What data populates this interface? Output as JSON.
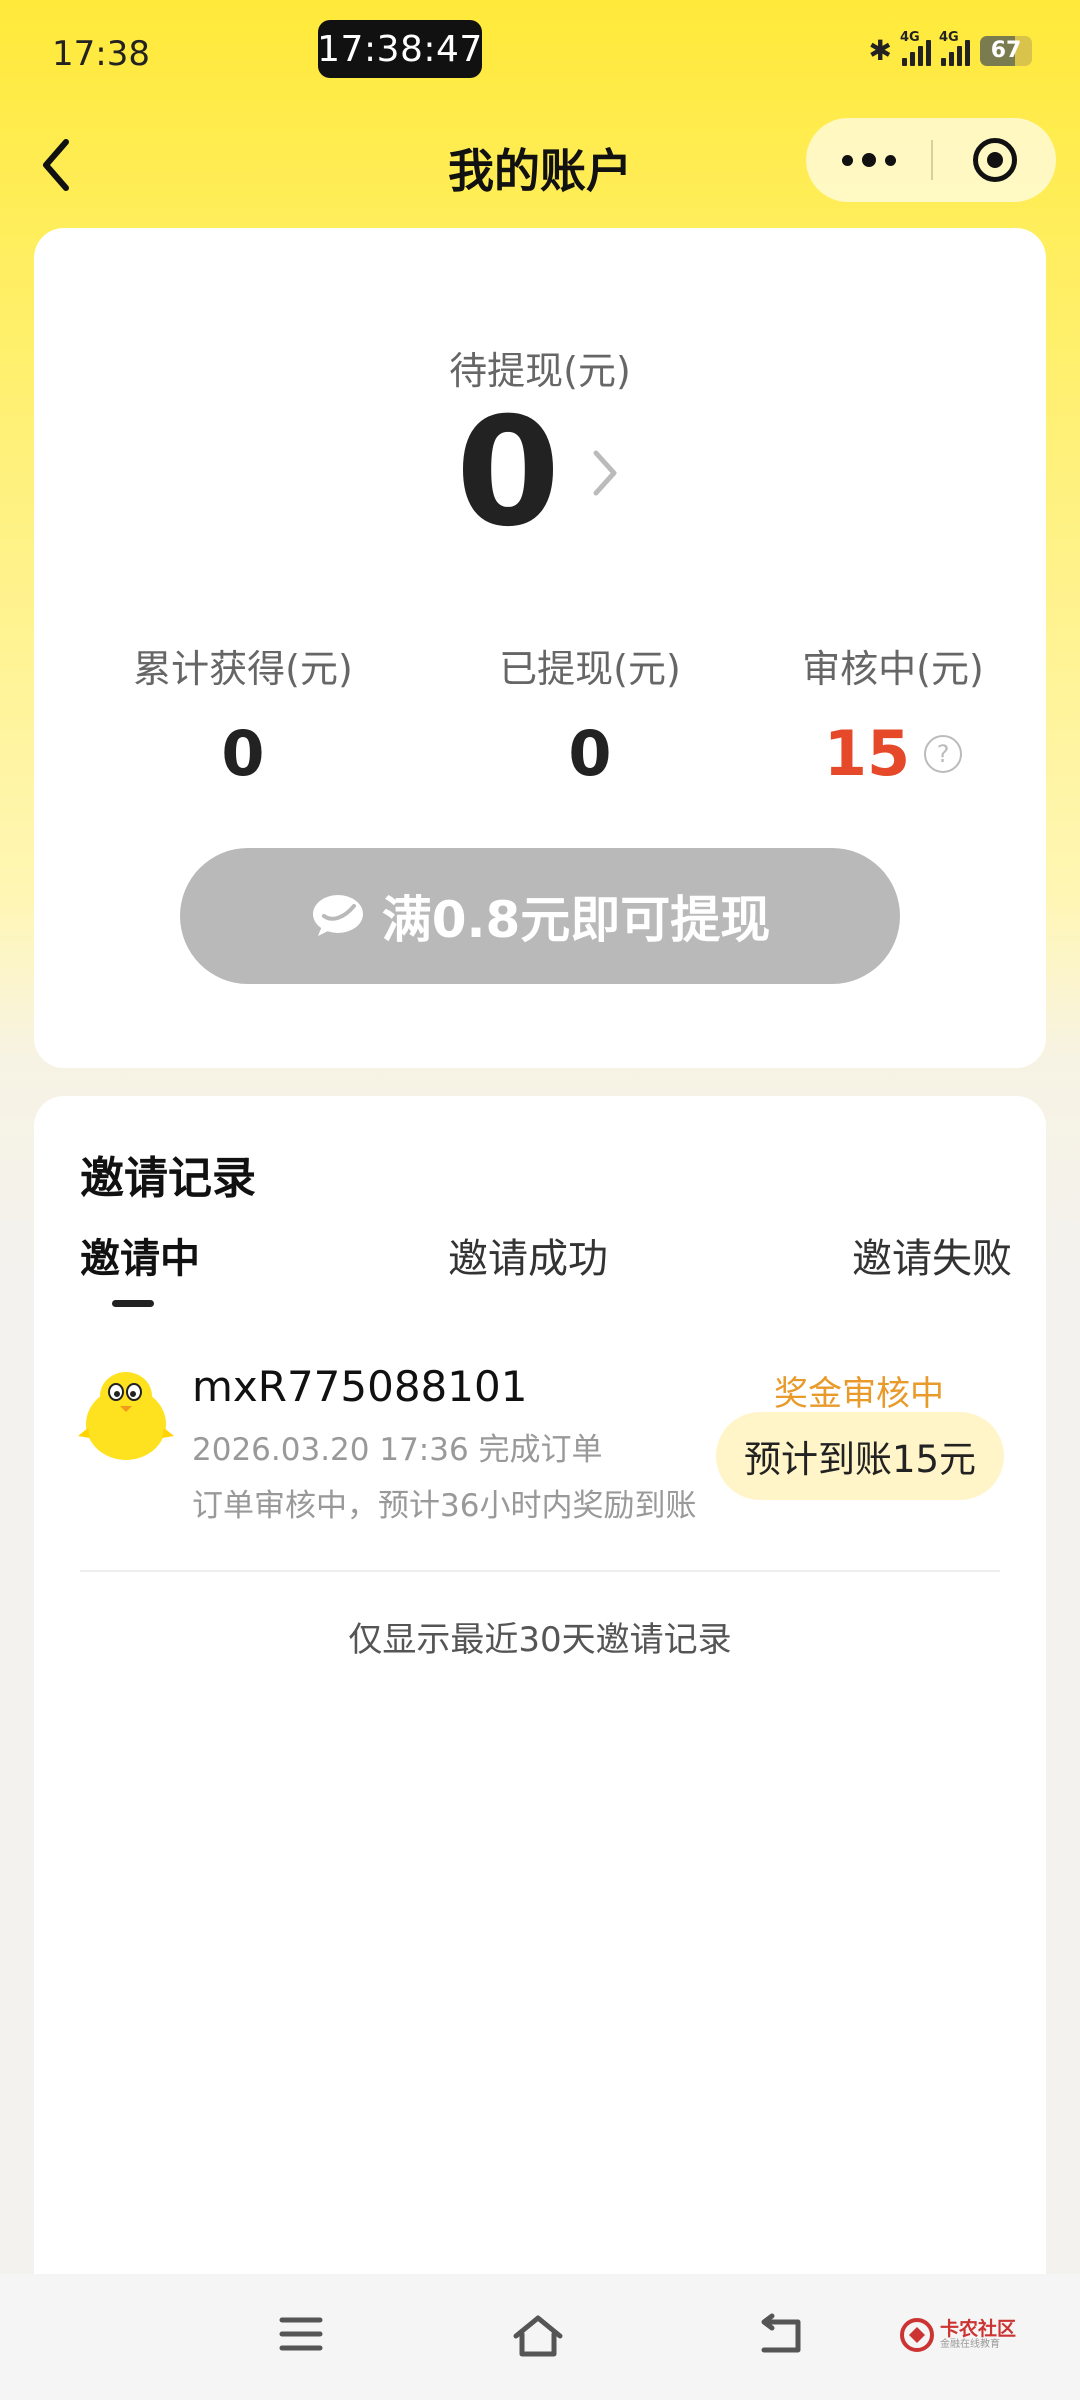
{
  "status_bar": {
    "time": "17:38",
    "center_clock": "17:38:47",
    "network_1": "4G",
    "network_2": "4G",
    "battery": "67",
    "battery_level": 0.67
  },
  "nav": {
    "title": "我的账户"
  },
  "balance": {
    "pending_label": "待提现(元)",
    "pending_value": "0",
    "stats": [
      {
        "label": "累计获得(元)",
        "value": "0"
      },
      {
        "label": "已提现(元)",
        "value": "0"
      },
      {
        "label": "审核中(元)",
        "value": "15"
      }
    ],
    "help_glyph": "?",
    "withdraw_button": "满0.8元即可提现"
  },
  "records": {
    "title": "邀请记录",
    "tabs": [
      "邀请中",
      "邀请成功",
      "邀请失败"
    ],
    "active_tab": 0,
    "items": [
      {
        "name": "mxR775088101",
        "time": "2026.03.20 17:36   完成订单",
        "note": "订单审核中，预计36小时内奖励到账",
        "status": "奖金审核中",
        "pill": "预计到账15元"
      }
    ],
    "footer": "仅显示最近30天邀请记录"
  },
  "watermark": {
    "main": "卡农社区",
    "sub": "金融在线教育"
  },
  "colors": {
    "accent_yellow": "#ffe93a",
    "review_red": "#e6492a",
    "status_orange": "#e89a2a",
    "disabled_gray": "#b9b9b9",
    "pill_bg": "#fff5c9"
  }
}
